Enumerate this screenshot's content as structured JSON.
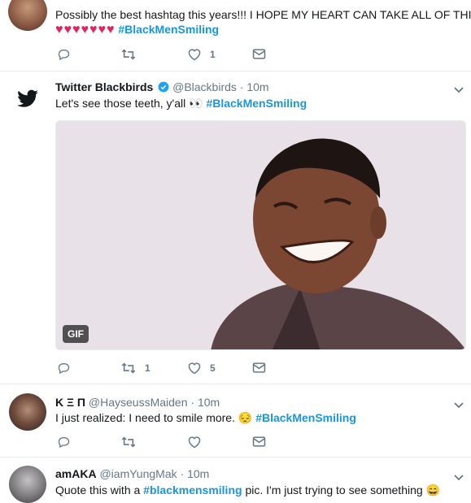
{
  "tweets": [
    {
      "id": "tweet-1",
      "header": "",
      "text": "Possibly the best hashtag this years!!! I HOPE MY HEART CAN TAKE ALL OF THIS!!!",
      "hearts": "♥♥♥♥♥♥♥",
      "hashtag": "#BlackMenSmiling",
      "reply_count": "",
      "retweet_count": "",
      "like_count": "1"
    },
    {
      "id": "tweet-2",
      "name": "Twitter Blackbirds",
      "verified": true,
      "handle": "@Blackbirds",
      "time": "· 10m",
      "text": "Let's see those teeth, y'all 👀",
      "hashtag": "#BlackMenSmiling",
      "media_badge": "GIF",
      "retweet_count": "1",
      "like_count": "5"
    },
    {
      "id": "tweet-3",
      "name": "Κ Ξ Π",
      "handle": "@HayseussMaiden",
      "time": "· 10m",
      "text": "I just realized: I need to smile more. 😔",
      "hashtag": "#BlackMenSmiling"
    },
    {
      "id": "tweet-4",
      "name": "amAKA",
      "handle": "@iamYungMak",
      "time": "· 10m",
      "text_before": "Quote this with a",
      "hashtag": "#blackmensmiling",
      "text_after": "pic. I'm just trying to see something 😄"
    }
  ],
  "colors": {
    "accent": "#1b95e0",
    "verified": "#1da1f2",
    "muted": "#657786",
    "heart": "#e0245e"
  },
  "icons": [
    "reply-icon",
    "retweet-icon",
    "like-icon",
    "message-icon",
    "chevron-down-icon",
    "twitter-bird-icon",
    "verified-icon"
  ]
}
